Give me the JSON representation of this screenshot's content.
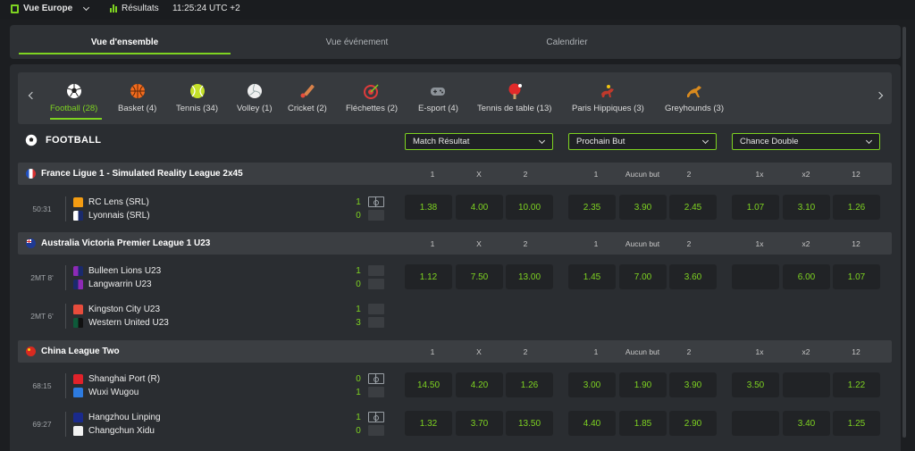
{
  "topbar": {
    "view": "Vue Europe",
    "results": "Résultats",
    "clock": "11:25:24 UTC +2"
  },
  "tabs": [
    "Vue d'ensemble",
    "Vue événement",
    "Calendrier"
  ],
  "sports": [
    {
      "label": "Football (28)",
      "icon": "football-icon",
      "color": "#ffffff"
    },
    {
      "label": "Basket (4)",
      "icon": "basketball-icon",
      "color": "#f26b1d"
    },
    {
      "label": "Tennis (34)",
      "icon": "tennis-icon",
      "color": "#c4e02a"
    },
    {
      "label": "Volley (1)",
      "icon": "volleyball-icon",
      "color": "#f0f0f0"
    },
    {
      "label": "Cricket (2)",
      "icon": "cricket-icon",
      "color": "#d9824a"
    },
    {
      "label": "Fléchettes (2)",
      "icon": "darts-icon",
      "color": "#e03b3b"
    },
    {
      "label": "E-sport (4)",
      "icon": "gamepad-icon",
      "color": "#8d9399"
    },
    {
      "label": "Tennis de table (13)",
      "icon": "table-tennis-icon",
      "color": "#e02a2a"
    },
    {
      "label": "Paris Hippiques (3)",
      "icon": "horse-racing-icon",
      "color": "#c0392b"
    },
    {
      "label": "Greyhounds (3)",
      "icon": "greyhound-icon",
      "color": "#d98a1e"
    }
  ],
  "section": {
    "title": "FOOTBALL",
    "markets": [
      "Match Résultat",
      "Prochain But",
      "Chance Double"
    ]
  },
  "col_headers": [
    "1",
    "X",
    "2",
    "1",
    "Aucun but",
    "2",
    "1x",
    "x2",
    "12"
  ],
  "leagues": [
    {
      "name": "France Ligue 1 - Simulated Reality League 2x45",
      "flag": "france",
      "matches": [
        {
          "time": "50:31",
          "home": "RC Lens (SRL)",
          "away": "Lyonnais (SRL)",
          "home_score": "1",
          "away_score": "0",
          "odds": [
            "1.38",
            "4.00",
            "10.00",
            "2.35",
            "3.90",
            "2.45",
            "1.07",
            "3.10",
            "1.26"
          ]
        }
      ]
    },
    {
      "name": "Australia Victoria Premier League 1 U23",
      "flag": "australia",
      "matches": [
        {
          "time": "2MT 8'",
          "home": "Bulleen Lions U23",
          "away": "Langwarrin U23",
          "home_score": "1",
          "away_score": "0",
          "odds": [
            "1.12",
            "7.50",
            "13.00",
            "1.45",
            "7.00",
            "3.60",
            "",
            "6.00",
            "1.07"
          ]
        },
        {
          "time": "2MT 6'",
          "home": "Kingston City U23",
          "away": "Western United U23",
          "home_score": "1",
          "away_score": "3",
          "odds": []
        }
      ]
    },
    {
      "name": "China League Two",
      "flag": "china",
      "matches": [
        {
          "time": "68:15",
          "home": "Shanghai Port (R)",
          "away": "Wuxi Wugou",
          "home_score": "0",
          "away_score": "1",
          "odds": [
            "14.50",
            "4.20",
            "1.26",
            "3.00",
            "1.90",
            "3.90",
            "3.50",
            "",
            "1.22"
          ]
        },
        {
          "time": "69:27",
          "home": "Hangzhou Linping",
          "away": "Changchun Xidu",
          "home_score": "1",
          "away_score": "0",
          "odds": [
            "1.32",
            "3.70",
            "13.50",
            "4.40",
            "1.85",
            "2.90",
            "",
            "3.40",
            "1.25"
          ]
        }
      ]
    }
  ]
}
